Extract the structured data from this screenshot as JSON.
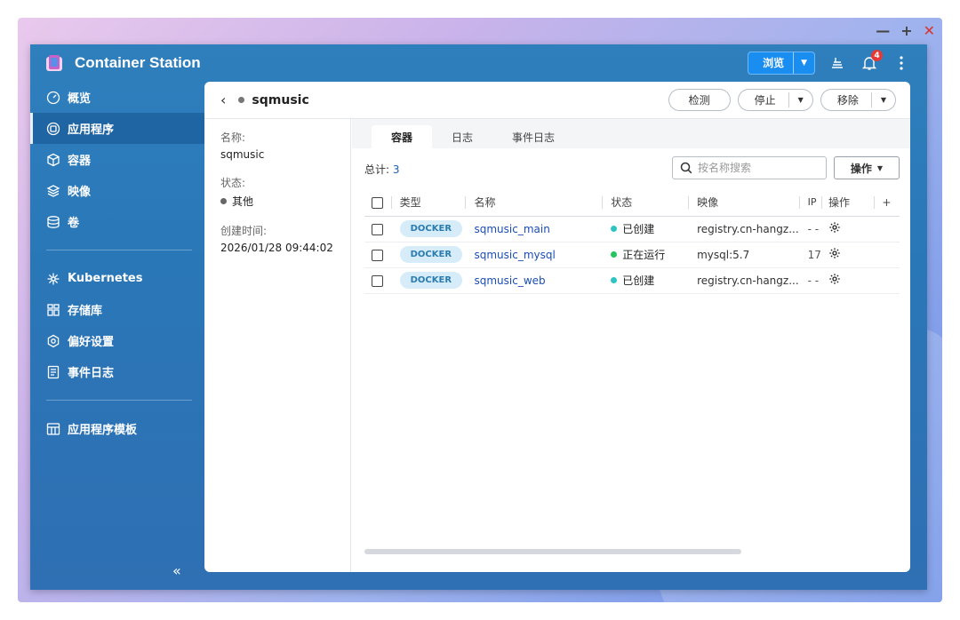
{
  "window_controls": {
    "minimize": "—",
    "maximize": "+",
    "close": "✕"
  },
  "app": {
    "title": "Container Station"
  },
  "titlebar": {
    "browse_label": "浏览",
    "notification_count": "4"
  },
  "sidebar": {
    "items": [
      {
        "label": "概览",
        "icon": "overview-icon"
      },
      {
        "label": "应用程序",
        "icon": "apps-icon",
        "active": true
      },
      {
        "label": "容器",
        "icon": "container-icon"
      },
      {
        "label": "映像",
        "icon": "image-layers-icon"
      },
      {
        "label": "卷",
        "icon": "volume-icon"
      },
      {
        "label": "Kubernetes",
        "icon": "kubernetes-icon"
      },
      {
        "label": "存储库",
        "icon": "repository-icon"
      },
      {
        "label": "偏好设置",
        "icon": "preferences-icon"
      },
      {
        "label": "事件日志",
        "icon": "event-log-icon"
      },
      {
        "label": "应用程序模板",
        "icon": "app-template-icon"
      }
    ],
    "collapse": "«"
  },
  "panel": {
    "app_name": "sqmusic",
    "buttons": {
      "detect": "检测",
      "stop": "停止",
      "remove": "移除"
    },
    "info": {
      "name_label": "名称:",
      "name_value": "sqmusic",
      "status_label": "状态:",
      "status_value": "其他",
      "created_label": "创建时间:",
      "created_value": "2026/01/28 09:44:02"
    },
    "tabs": [
      "容器",
      "日志",
      "事件日志"
    ],
    "total_label": "总计:",
    "total_count": "3",
    "search_placeholder": "按名称搜索",
    "ops_label": "操作",
    "table": {
      "headers": {
        "type": "类型",
        "name": "名称",
        "status": "状态",
        "image": "映像",
        "ip": "IP",
        "ops": "操作",
        "add": "+"
      },
      "rows": [
        {
          "type": "DOCKER",
          "name": "sqmusic_main",
          "status": "已创建",
          "status_color": "#2ec4c4",
          "image": "registry.cn-hangz...",
          "ip": "- -"
        },
        {
          "type": "DOCKER",
          "name": "sqmusic_mysql",
          "status": "正在运行",
          "status_color": "#22c55e",
          "image": "mysql:5.7",
          "ip": "17"
        },
        {
          "type": "DOCKER",
          "name": "sqmusic_web",
          "status": "已创建",
          "status_color": "#2ec4c4",
          "image": "registry.cn-hangz...",
          "ip": "- -"
        }
      ]
    }
  }
}
